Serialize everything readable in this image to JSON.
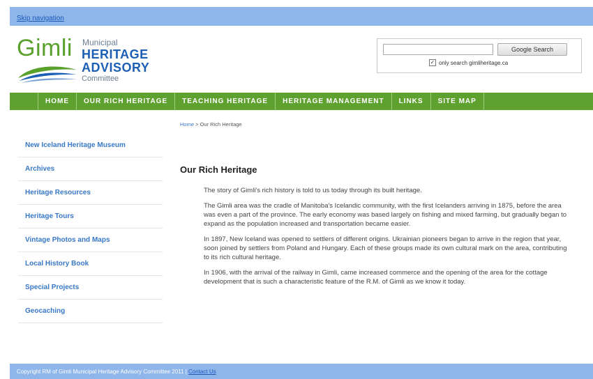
{
  "skip_link": "Skip navigation",
  "logo": {
    "gimli": "Gimli",
    "municipal": "Municipal",
    "heritage": "HERITAGE",
    "advisory": "ADVISORY",
    "committee": "Committee"
  },
  "search": {
    "placeholder": "",
    "button_label": "Google Search",
    "only_search_label": "only search gimliheritage.ca",
    "only_search_checked": true
  },
  "nav": {
    "items": [
      "HOME",
      "OUR RICH HERITAGE",
      "TEACHING HERITAGE",
      "HERITAGE MANAGEMENT",
      "LINKS",
      "SITE MAP"
    ]
  },
  "sidebar": {
    "items": [
      "New Iceland Heritage Museum",
      "Archives",
      "Heritage Resources",
      "Heritage Tours",
      "Vintage Photos and Maps",
      "Local History Book",
      "Special Projects",
      "Geocaching"
    ]
  },
  "breadcrumb": {
    "home": "Home",
    "separator": " > ",
    "current": "Our Rich Heritage"
  },
  "main": {
    "title": "Our Rich Heritage",
    "paragraphs": [
      "The story of Gimli's rich history is told to us today through its built heritage.",
      "The Gimli area was the cradle of Manitoba's Icelandic community, with the first Icelanders arriving in 1875, before the area was even a part of the province. The early economy was based largely on fishing and mixed farming, but gradually began to expand as the population increased and transportation became easier.",
      "In 1897, New Iceland was opened to settlers of different origins. Ukrainian pioneers began to arrive in the region that year, soon joined by settlers from Poland and Hungary. Each of these groups made its own cultural mark on the area, contributing to its rich cultural heritage.",
      "In 1906, with the arrival of the railway in Gimli, came increased commerce and the opening of the area for the cottage development that is such a characteristic feature of the R.M. of Gimli as we know it today."
    ]
  },
  "footer": {
    "copyright": "Copyright RM of Gimli Municipal Heritage Advisory Committee 2011 |",
    "contact": "Contact Us"
  },
  "colors": {
    "nav_green": "#5fa12f",
    "top_blue": "#8fb6ea",
    "link_blue": "#3878c5",
    "logo_green": "#5aa02c",
    "logo_blue": "#1c5fb5"
  }
}
